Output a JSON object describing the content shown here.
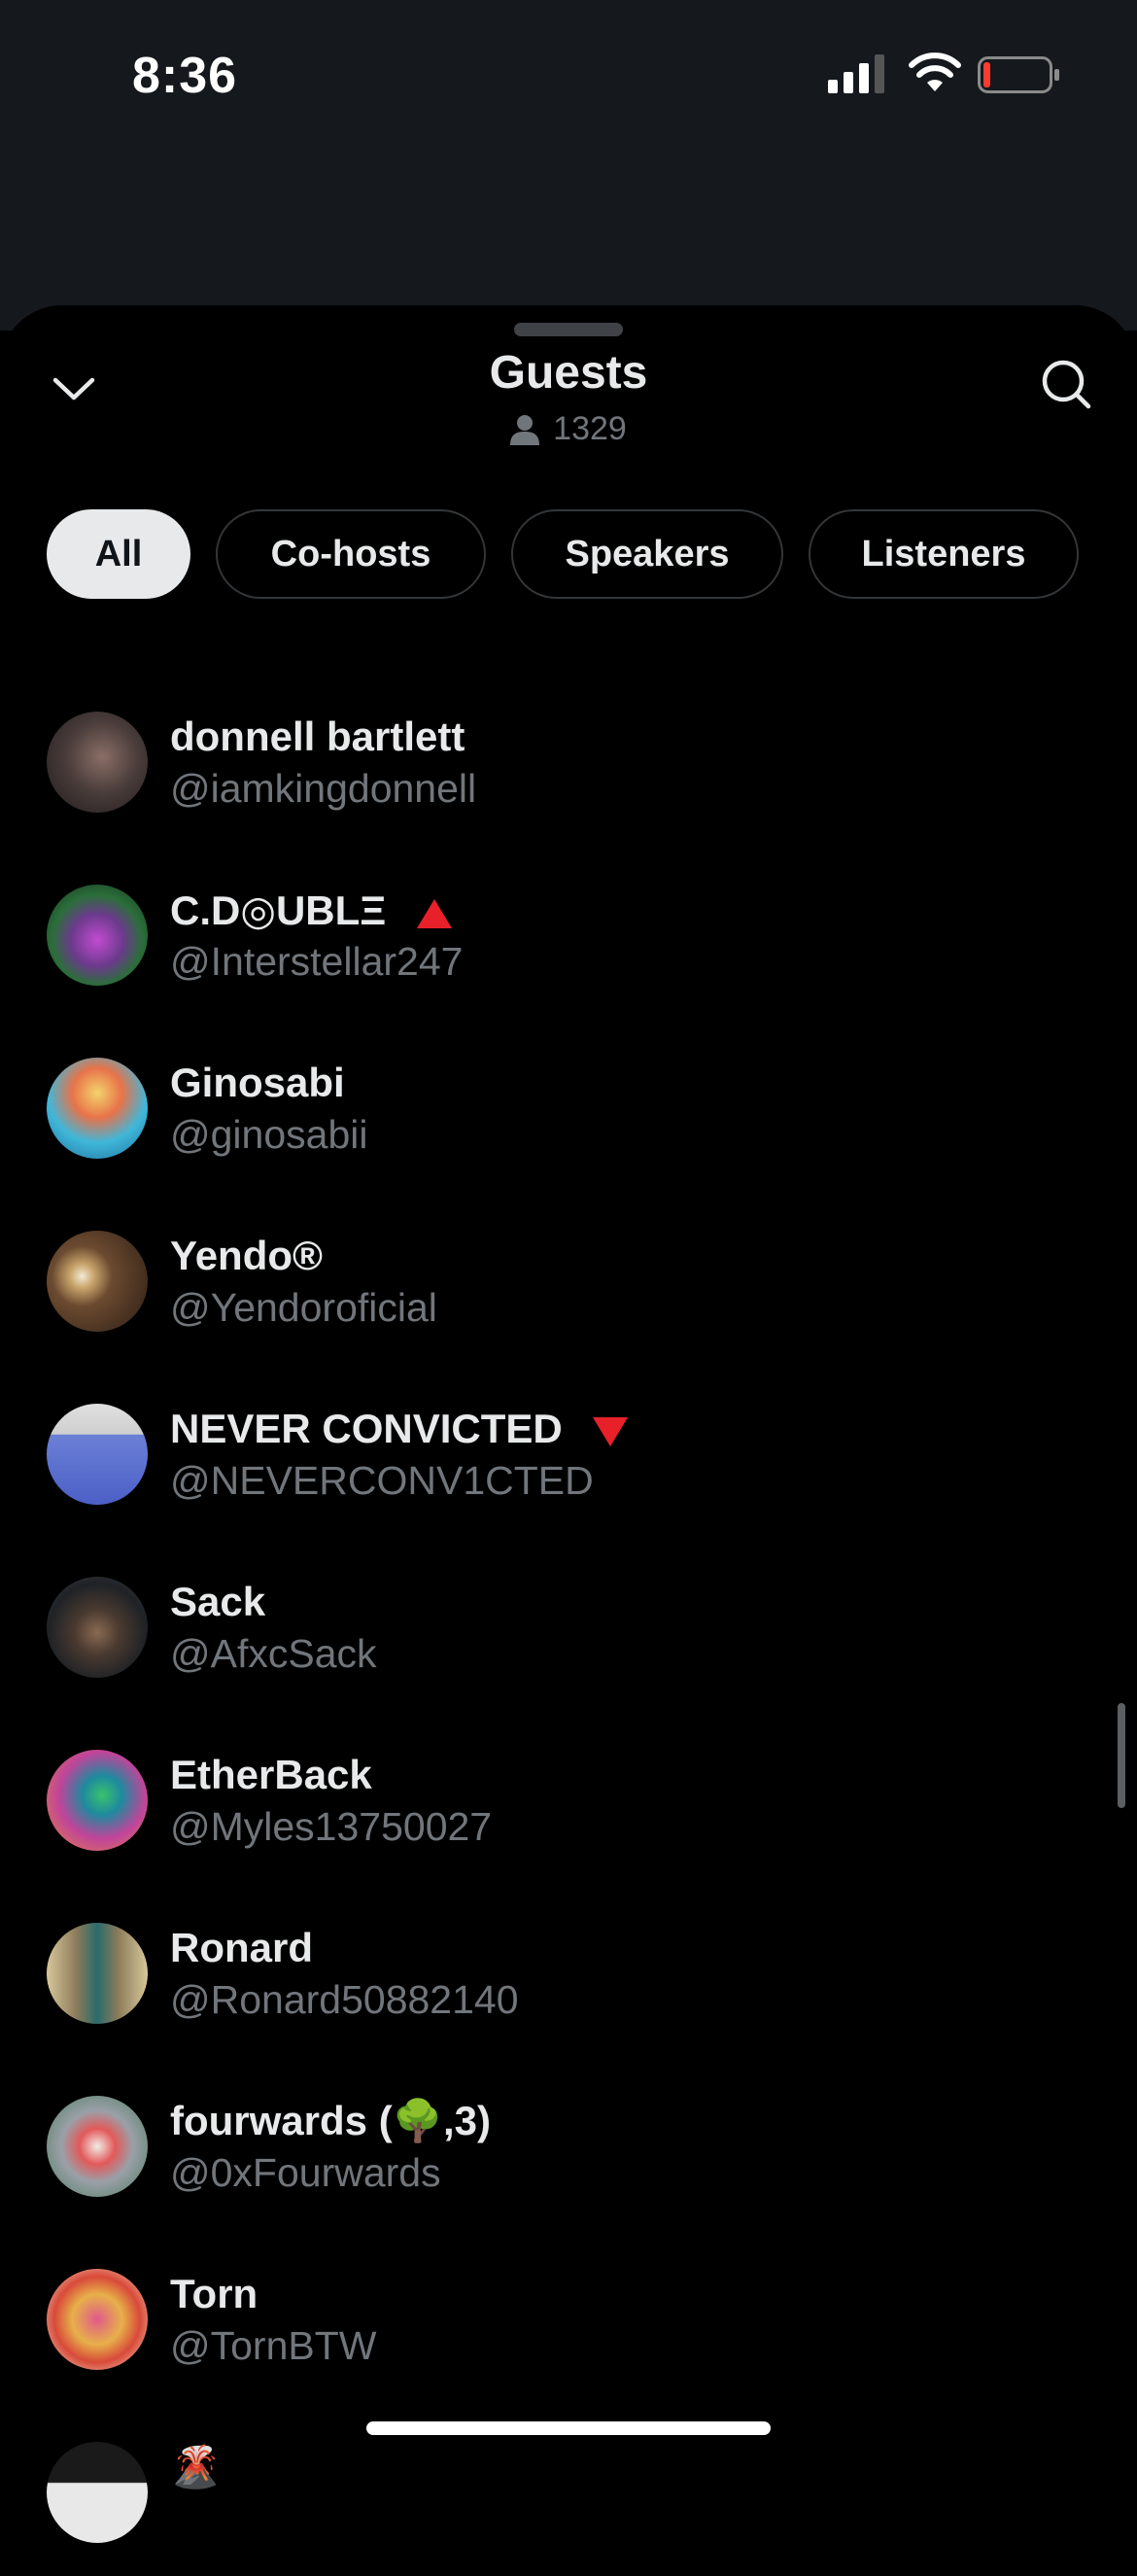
{
  "status_bar": {
    "time": "8:36"
  },
  "sheet": {
    "title": "Guests",
    "guest_count": "1329",
    "filters": [
      {
        "label": "All",
        "active": true
      },
      {
        "label": "Co-hosts",
        "active": false
      },
      {
        "label": "Speakers",
        "active": false
      },
      {
        "label": "Listeners",
        "active": false
      }
    ]
  },
  "guests": [
    {
      "name": "donnell bartlett",
      "handle": "@iamkingdonnell",
      "avatar_color": "#5a4a48"
    },
    {
      "name": "C.D◎UBLΞ",
      "handle": "@Interstellar247",
      "avatar_color": "#2b6e3a",
      "badge": "up"
    },
    {
      "name": "Ginosabi",
      "handle": "@ginosabii",
      "avatar_color": "#3fb7d9"
    },
    {
      "name": "Yendo®",
      "handle": "@Yendoroficial",
      "avatar_color": "#6b4a30"
    },
    {
      "name": "NEVER CONVICTED",
      "handle": "@NEVERCONV1CTED",
      "avatar_color": "#6b7fd6",
      "badge": "down"
    },
    {
      "name": "Sack",
      "handle": "@AfxcSack",
      "avatar_color": "#3a3e44"
    },
    {
      "name": "EtherBack",
      "handle": "@Myles13750027",
      "avatar_color": "#c0449a"
    },
    {
      "name": "Ronard",
      "handle": "@Ronard50882140",
      "avatar_color": "#8a7a5a"
    },
    {
      "name": "fourwards (🌳,3)",
      "handle": "@0xFourwards",
      "avatar_color": "#9aa0a8"
    },
    {
      "name": "Torn",
      "handle": "@TornBTW",
      "avatar_color": "#e7b04a"
    },
    {
      "name": "🌋",
      "handle": "",
      "avatar_color": "#e8e8e8"
    }
  ],
  "colors": {
    "background": "#000000",
    "text_primary": "#e7e9ea",
    "text_secondary": "#71767b",
    "border": "#333639",
    "up_triangle": "#e8202a",
    "down_triangle": "#e8202a"
  }
}
